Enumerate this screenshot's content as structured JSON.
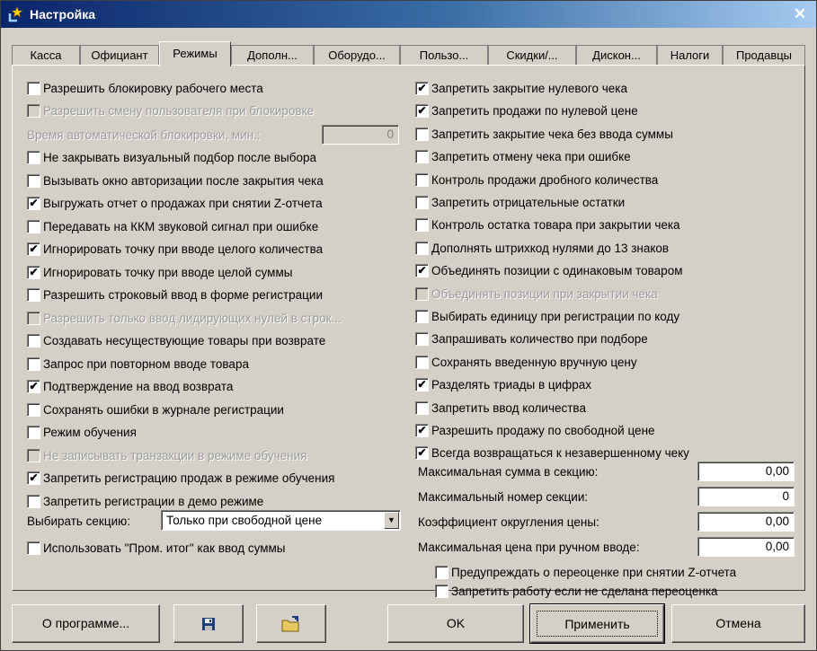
{
  "window": {
    "title": "Настройка"
  },
  "tabs": [
    {
      "label": "Касса"
    },
    {
      "label": "Официант"
    },
    {
      "label": "Режимы"
    },
    {
      "label": "Дополн..."
    },
    {
      "label": "Оборудо..."
    },
    {
      "label": "Пользо..."
    },
    {
      "label": "Скидки/..."
    },
    {
      "label": "Дискон..."
    },
    {
      "label": "Налоги"
    },
    {
      "label": "Продавцы"
    }
  ],
  "active_tab": "Режимы",
  "left": {
    "block_workplace": {
      "label": "Разрешить блокировку рабочего места",
      "checked": false,
      "enabled": true
    },
    "change_user_on_block": {
      "label": "Разрешить смену пользователя при блокировке",
      "checked": false,
      "enabled": false
    },
    "auto_block_time": {
      "label": "Время автоматической блокировки, мин.:",
      "value": "0",
      "enabled": false
    },
    "items": [
      {
        "label": "Не закрывать визуальный подбор после выбора",
        "check": "",
        "enabled": true
      },
      {
        "label": "Вызывать окно авторизации после закрытия чека",
        "check": "",
        "enabled": true
      },
      {
        "label": "Выгружать отчет о продажах при снятии Z-отчета",
        "check": "✔",
        "enabled": true
      },
      {
        "label": "Передавать на ККМ звуковой сигнал при ошибке",
        "check": "",
        "enabled": true
      },
      {
        "label": "Игнорировать точку при вводе целого количества",
        "check": "✔",
        "enabled": true
      },
      {
        "label": "Игнорировать точку при вводе целой суммы",
        "check": "✔",
        "enabled": true
      },
      {
        "label": "Разрешить строковый ввод в форме регистрации",
        "check": "",
        "enabled": true
      },
      {
        "label": "Разрешить только ввод лидирующих нулей в строк...",
        "check": "",
        "enabled": false
      },
      {
        "label": "Создавать несуществующие товары при возврате",
        "check": "",
        "enabled": true
      },
      {
        "label": "Запрос при повторном вводе товара",
        "check": "",
        "enabled": true
      },
      {
        "label": "Подтверждение на ввод возврата",
        "check": "✔",
        "enabled": true
      },
      {
        "label": "Сохранять ошибки в журнале регистрации",
        "check": "",
        "enabled": true
      },
      {
        "label": "Режим обучения",
        "check": "",
        "enabled": true
      },
      {
        "label": "Не записывать транзакции в режиме обучения",
        "check": "",
        "enabled": false
      },
      {
        "label": "Запретить регистрацию продаж в режиме обучения",
        "check": "✔",
        "enabled": true
      },
      {
        "label": "Запретить регистрации в демо режиме",
        "check": "",
        "enabled": true
      }
    ],
    "section_select": {
      "label": "Выбирать секцию:",
      "value": "Только при свободной цене"
    },
    "use_subtotal": {
      "label": "Использовать \"Пром. итог\" как ввод суммы",
      "check": "",
      "enabled": true
    }
  },
  "right": {
    "items": [
      {
        "label": "Запретить закрытие нулевого чека",
        "check": "✔",
        "enabled": true
      },
      {
        "label": "Запретить продажи по нулевой цене",
        "check": "✔",
        "enabled": true
      },
      {
        "label": "Запретить закрытие чека без ввода суммы",
        "check": "",
        "enabled": true
      },
      {
        "label": "Запретить отмену чека при ошибке",
        "check": "",
        "enabled": true
      },
      {
        "label": "Контроль продажи дробного количества",
        "check": "",
        "enabled": true
      },
      {
        "label": "Запретить отрицательные остатки",
        "check": "",
        "enabled": true
      },
      {
        "label": "Контроль остатка товара при закрытии чека",
        "check": "",
        "enabled": true
      },
      {
        "label": "Дополнять штрихкод нулями до 13 знаков",
        "check": "",
        "enabled": true
      },
      {
        "label": "Объединять позиции с одинаковым товаром",
        "check": "✔",
        "enabled": true
      },
      {
        "label": "Объединять позиции при закрытии чека",
        "check": "",
        "enabled": false
      },
      {
        "label": "Выбирать единицу при регистрации по коду",
        "check": "",
        "enabled": true
      },
      {
        "label": "Запрашивать количество при подборе",
        "check": "",
        "enabled": true
      },
      {
        "label": "Сохранять введенную вручную цену",
        "check": "",
        "enabled": true
      },
      {
        "label": "Разделять триады в цифрах",
        "check": "✔",
        "enabled": true
      },
      {
        "label": "Запретить ввод количества",
        "check": "",
        "enabled": true
      },
      {
        "label": "Разрешить продажу по свободной цене",
        "check": "✔",
        "enabled": true
      },
      {
        "label": "Всегда возвращаться к незавершенному чеку",
        "check": "✔",
        "enabled": true
      }
    ],
    "fields": [
      {
        "label": "Максимальная сумма в секцию:",
        "value": "0,00"
      },
      {
        "label": "Максимальный номер секции:",
        "value": "0"
      },
      {
        "label": "Коэффициент округления цены:",
        "value": "0,00"
      },
      {
        "label": "Максимальная цена при ручном вводе:",
        "value": "0,00"
      }
    ],
    "bottom_items": [
      {
        "label": "Предупреждать о переоценке при снятии Z-отчета",
        "check": "",
        "enabled": true
      },
      {
        "label": "Запретить работу если не сделана переоценка",
        "check": "",
        "enabled": true
      }
    ]
  },
  "buttons": {
    "about": "О программе...",
    "save_icon": "save-icon",
    "open_icon": "open-folder-icon",
    "ok": "OK",
    "apply": "Применить",
    "cancel": "Отмена"
  }
}
